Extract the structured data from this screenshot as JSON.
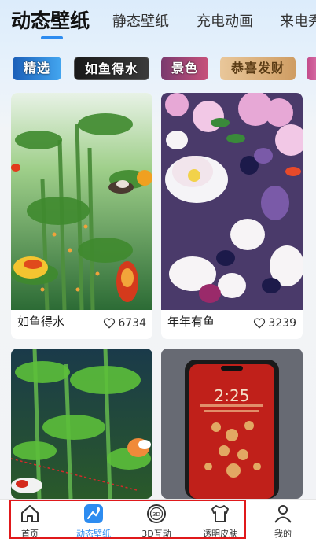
{
  "tabs": [
    {
      "label": "动态壁纸",
      "active": true
    },
    {
      "label": "静态壁纸",
      "active": false
    },
    {
      "label": "充电动画",
      "active": false
    },
    {
      "label": "来电秀",
      "active": false
    }
  ],
  "chips": [
    "精选",
    "如鱼得水",
    "景色",
    "恭喜发财"
  ],
  "cards": [
    {
      "title": "如鱼得水",
      "likes": "6734"
    },
    {
      "title": "年年有鱼",
      "likes": "3239"
    },
    {
      "title": "",
      "likes": ""
    },
    {
      "title": "",
      "likes": ""
    }
  ],
  "phone_overlay": {
    "time": "2:25"
  },
  "bottom_nav": [
    {
      "label": "首页",
      "icon": "home-icon"
    },
    {
      "label": "动态壁纸",
      "icon": "dynamic-wallpaper-icon"
    },
    {
      "label": "3D互动",
      "icon": "3d-icon"
    },
    {
      "label": "透明皮肤",
      "icon": "tshirt-icon"
    },
    {
      "label": "我的",
      "icon": "person-icon"
    }
  ],
  "colors": {
    "accent": "#2d8cf0",
    "highlight": "#e0191b"
  }
}
